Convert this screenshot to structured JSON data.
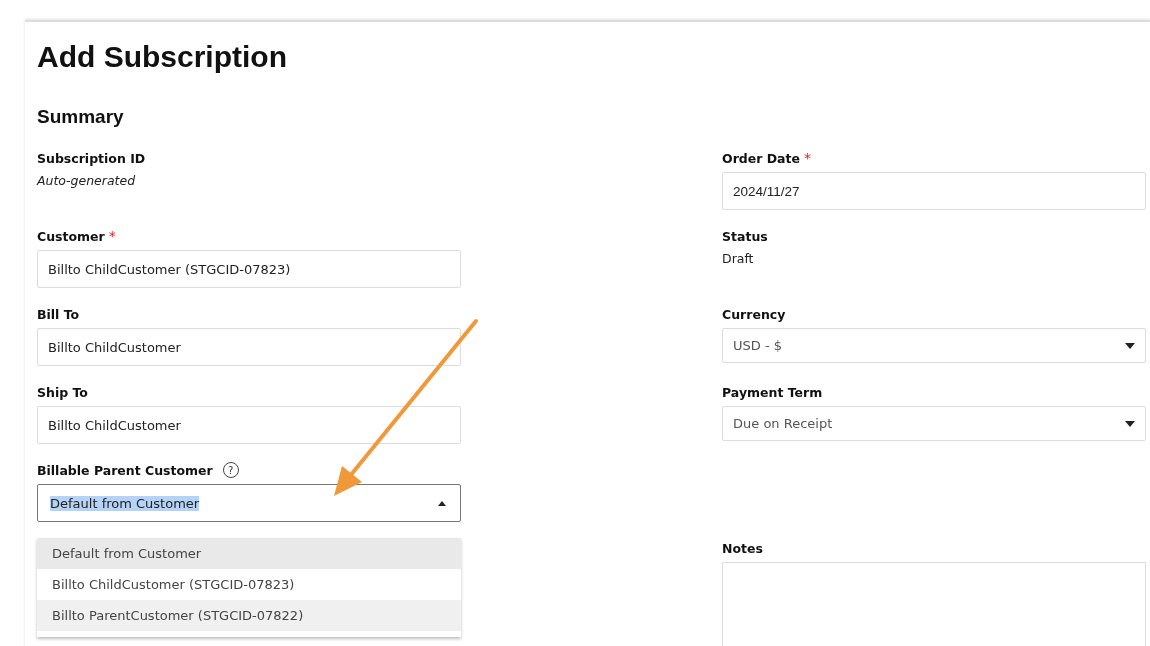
{
  "page": {
    "title": "Add Subscription",
    "section": "Summary"
  },
  "left_fields": [
    {
      "kind": "readonly",
      "label": "Subscription ID",
      "value": "Auto-generated",
      "italic": true
    },
    {
      "kind": "input",
      "label": "Customer",
      "required_mark": "*",
      "value": "Billto ChildCustomer (STGCID-07823)"
    },
    {
      "kind": "input",
      "label": "Bill To",
      "value": "Billto ChildCustomer"
    },
    {
      "kind": "input",
      "label": "Ship To",
      "value": "Billto ChildCustomer"
    },
    {
      "kind": "combo",
      "label": "Billable Parent Customer",
      "help": "?",
      "value": "Default from Customer",
      "expanded": true,
      "options": [
        {
          "label": "Default from Customer",
          "selected": true,
          "hovered": false
        },
        {
          "label": "Billto ChildCustomer (STGCID-07823)",
          "selected": false,
          "hovered": false
        },
        {
          "label": "Billto ParentCustomer (STGCID-07822)",
          "selected": false,
          "hovered": true
        }
      ]
    }
  ],
  "right_fields": [
    {
      "kind": "input",
      "label": "Order Date",
      "required_mark": "*",
      "value": "2024/11/27"
    },
    {
      "kind": "readonly",
      "label": "Status",
      "value": "Draft",
      "italic": false
    },
    {
      "kind": "select",
      "label": "Currency",
      "value": "USD - $"
    },
    {
      "kind": "select",
      "label": "Payment Term",
      "value": "Due on Receipt"
    },
    {
      "kind": "empty"
    },
    {
      "kind": "textarea",
      "label": "Notes"
    }
  ]
}
